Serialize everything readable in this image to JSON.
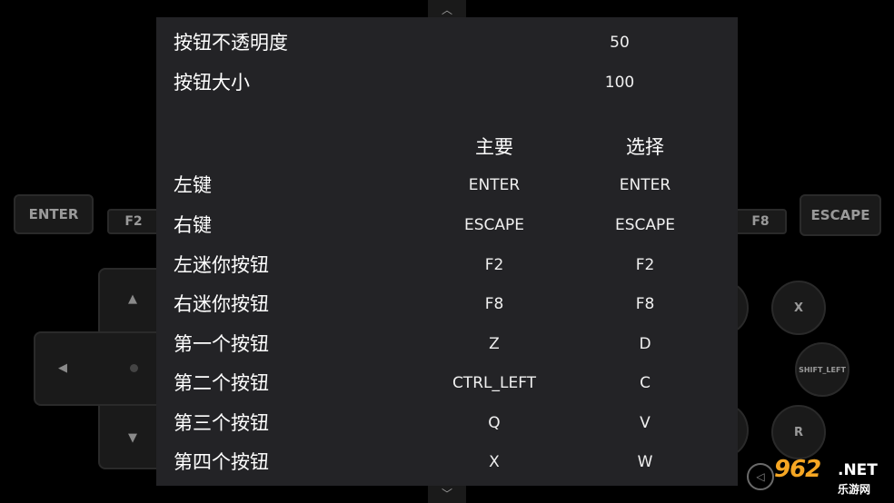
{
  "overlay": {
    "enter_label": "ENTER",
    "f2_label": "F2",
    "f8_label": "F8",
    "escape_label": "ESCAPE",
    "x_label": "X",
    "shift_left_label": "SHIFT_LEFT",
    "r_label": "R",
    "arrow_up": "▲",
    "arrow_down": "▼",
    "arrow_left": "◀",
    "chevron_up": "︿",
    "chevron_down": "﹀"
  },
  "settings": {
    "opacity": {
      "label": "按钮不透明度",
      "value": "50"
    },
    "size": {
      "label": "按钮大小",
      "value": "100"
    },
    "columns": {
      "main": "主要",
      "alt": "选择"
    },
    "bindings": [
      {
        "label": "左键",
        "main": "ENTER",
        "alt": "ENTER"
      },
      {
        "label": "右键",
        "main": "ESCAPE",
        "alt": "ESCAPE"
      },
      {
        "label": "左迷你按钮",
        "main": "F2",
        "alt": "F2"
      },
      {
        "label": "右迷你按钮",
        "main": "F8",
        "alt": "F8"
      },
      {
        "label": "第一个按钮",
        "main": "Z",
        "alt": "D"
      },
      {
        "label": "第二个按钮",
        "main": "CTRL_LEFT",
        "alt": "C"
      },
      {
        "label": "第三个按钮",
        "main": "Q",
        "alt": "V"
      },
      {
        "label": "第四个按钮",
        "main": "X",
        "alt": "W"
      }
    ]
  },
  "watermark": {
    "logo": "962",
    "net": ".NET",
    "sub": "乐游网"
  }
}
